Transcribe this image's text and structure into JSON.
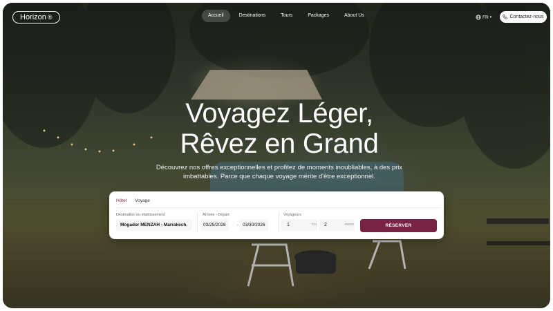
{
  "brand": {
    "name": "Horizon",
    "mark": "®"
  },
  "nav": {
    "items": [
      {
        "label": "Accueil",
        "active": true
      },
      {
        "label": "Destinations",
        "active": false
      },
      {
        "label": "Tours",
        "active": false
      },
      {
        "label": "Packages",
        "active": false
      },
      {
        "label": "About Us",
        "active": false
      }
    ],
    "language": "FR",
    "contact_label": "Contactez-nous"
  },
  "hero": {
    "headline_line1": "Voyagez Léger,",
    "headline_line2": "Rêvez en Grand",
    "subtitle": "Découvrez nos offres exceptionnelles et profitez de moments inoubliables, à des prix imbattables. Parce que chaque voyage mérite d'être exceptionnel."
  },
  "booking": {
    "tabs": [
      {
        "label": "Hôtel",
        "active": true
      },
      {
        "label": "Voyage",
        "active": false
      }
    ],
    "destination": {
      "label": "Destination ou établissement",
      "value": "Mogador MENZAH - Marrakech"
    },
    "dates": {
      "label": "Arrivée - Départ",
      "arrival": "03/29/2026",
      "separator": "-",
      "departure": "03/30/2026"
    },
    "travelers": {
      "label": "Voyageurs",
      "rooms": "1",
      "rooms_unit": "CH",
      "persons": "2",
      "persons_unit": "PERS"
    },
    "submit_label": "RÉSERVER"
  },
  "colors": {
    "accent": "#7a2146",
    "text_dark": "#111111"
  },
  "icons": {
    "language": "globe-icon",
    "contact": "phone-icon",
    "dropdown": "chevron-down-icon"
  }
}
